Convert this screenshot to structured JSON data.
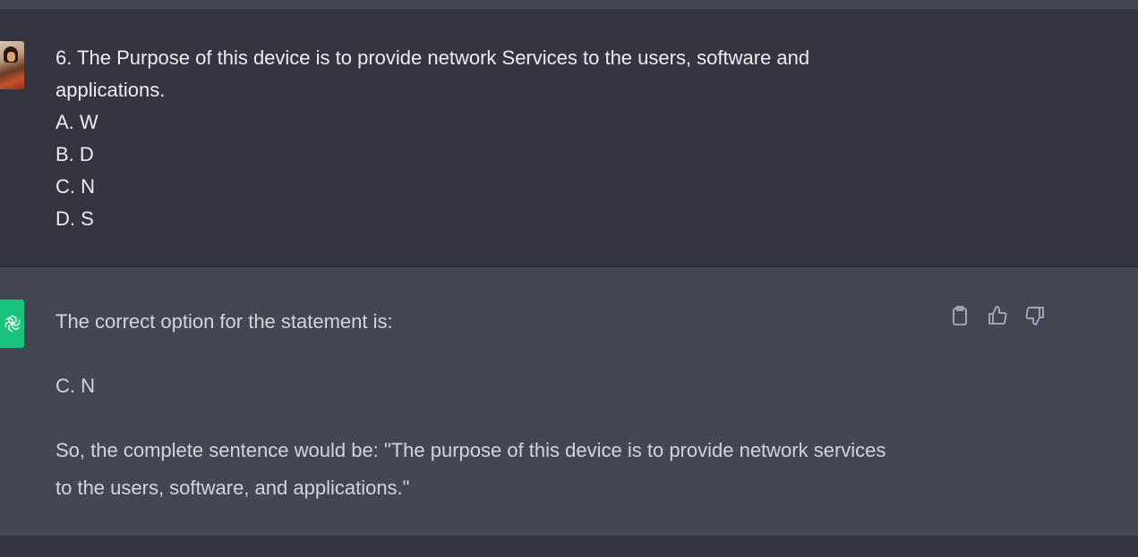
{
  "conversation": {
    "user_message": {
      "lines": [
        "6. The Purpose of this device is to provide network Services to the users, software and applications.",
        "A. W",
        "B. D",
        "C. N",
        "D. S"
      ]
    },
    "assistant_message": {
      "paragraphs": [
        "The correct option for the statement is:",
        "C. N",
        "So, the complete sentence would be: \"The purpose of this device is to provide network services to the users, software, and applications.\""
      ],
      "actions": {
        "copy_icon": "clipboard-icon",
        "like_icon": "thumbs-up-icon",
        "dislike_icon": "thumbs-down-icon"
      }
    }
  },
  "colors": {
    "user_bg": "#343541",
    "assistant_bg": "#444654",
    "gpt_logo_bg": "#19c37d"
  }
}
